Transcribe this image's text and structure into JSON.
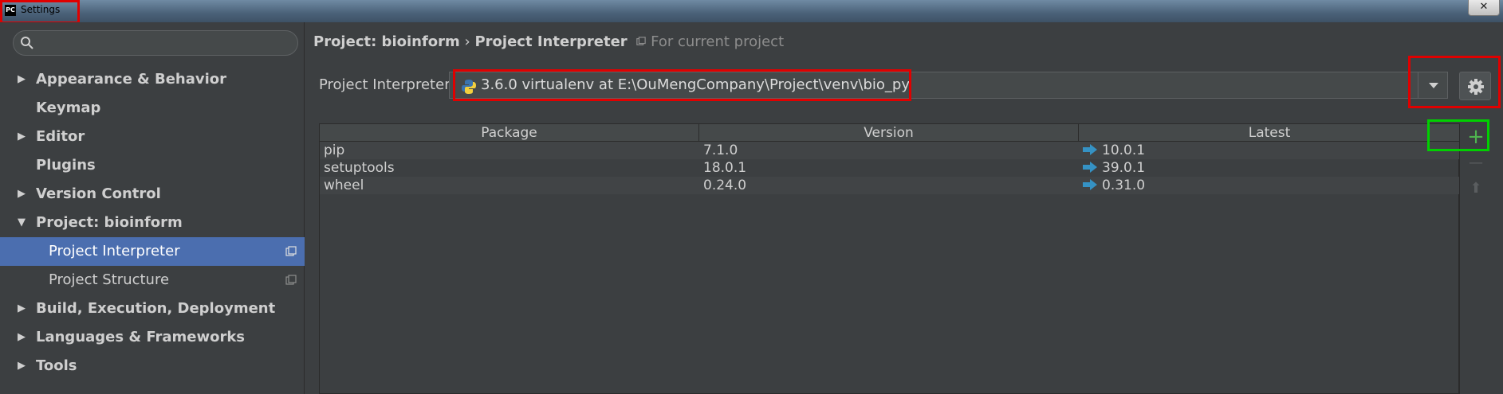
{
  "window": {
    "title": "Settings",
    "app_icon": "PC",
    "close_label": "✕"
  },
  "sidebar": {
    "search": {
      "placeholder": ""
    },
    "items": [
      {
        "label": "Appearance & Behavior",
        "arrow": "▶",
        "level": 1
      },
      {
        "label": "Keymap",
        "arrow": "",
        "level": 1
      },
      {
        "label": "Editor",
        "arrow": "▶",
        "level": 1
      },
      {
        "label": "Plugins",
        "arrow": "",
        "level": 1
      },
      {
        "label": "Version Control",
        "arrow": "▶",
        "level": 1
      },
      {
        "label": "Project: bioinform",
        "arrow": "▼",
        "level": 1
      },
      {
        "label": "Project Interpreter",
        "arrow": "",
        "level": 2,
        "selected": true
      },
      {
        "label": "Project Structure",
        "arrow": "",
        "level": 2
      },
      {
        "label": "Build, Execution, Deployment",
        "arrow": "▶",
        "level": 1
      },
      {
        "label": "Languages & Frameworks",
        "arrow": "▶",
        "level": 1
      },
      {
        "label": "Tools",
        "arrow": "▶",
        "level": 1
      }
    ]
  },
  "breadcrumb": {
    "project": "Project: bioinform",
    "separator": "›",
    "page": "Project Interpreter",
    "note": "For current project"
  },
  "interpreter": {
    "label": "Project Interpreter:",
    "value": "3.6.0 virtualenv at E:\\OuMengCompany\\Project\\venv\\bio_py"
  },
  "table": {
    "headers": [
      "Package",
      "Version",
      "Latest"
    ],
    "rows": [
      {
        "package": "pip",
        "version": "7.1.0",
        "latest": "10.0.1"
      },
      {
        "package": "setuptools",
        "version": "18.0.1",
        "latest": "39.0.1"
      },
      {
        "package": "wheel",
        "version": "0.24.0",
        "latest": "0.31.0"
      }
    ]
  },
  "toolbar": {
    "add": "+",
    "remove": "—",
    "upgrade": "⬆"
  },
  "colors": {
    "background": "#3c3f41",
    "selection": "#4b6eaf",
    "highlight_red": "#e00000",
    "highlight_green": "#00d000",
    "add_green": "#4fb44f",
    "upgrade_arrow": "#3592c4"
  }
}
